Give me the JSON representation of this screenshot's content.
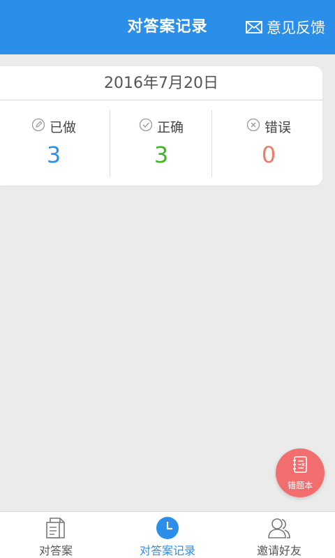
{
  "header": {
    "title": "对答案记录",
    "feedback_label": "意见反馈"
  },
  "record": {
    "date": "2016年7月20日",
    "stats": [
      {
        "label": "已做",
        "value": "3",
        "icon": "pencil-circle-icon",
        "color": "#2b8ee8"
      },
      {
        "label": "正确",
        "value": "3",
        "icon": "check-circle-icon",
        "color": "#3cb81e"
      },
      {
        "label": "错误",
        "value": "0",
        "icon": "x-circle-icon",
        "color": "#f07a6a"
      }
    ]
  },
  "fab": {
    "label": "错题本",
    "icon": "notebook-icon",
    "color": "#f26e6e"
  },
  "tabs": [
    {
      "label": "对答案",
      "icon": "document-icon",
      "active": false
    },
    {
      "label": "对答案记录",
      "icon": "clock-icon",
      "active": true
    },
    {
      "label": "邀请好友",
      "icon": "friends-icon",
      "active": false
    }
  ],
  "colors": {
    "accent": "#2b8ee8",
    "background": "#ebebeb"
  }
}
